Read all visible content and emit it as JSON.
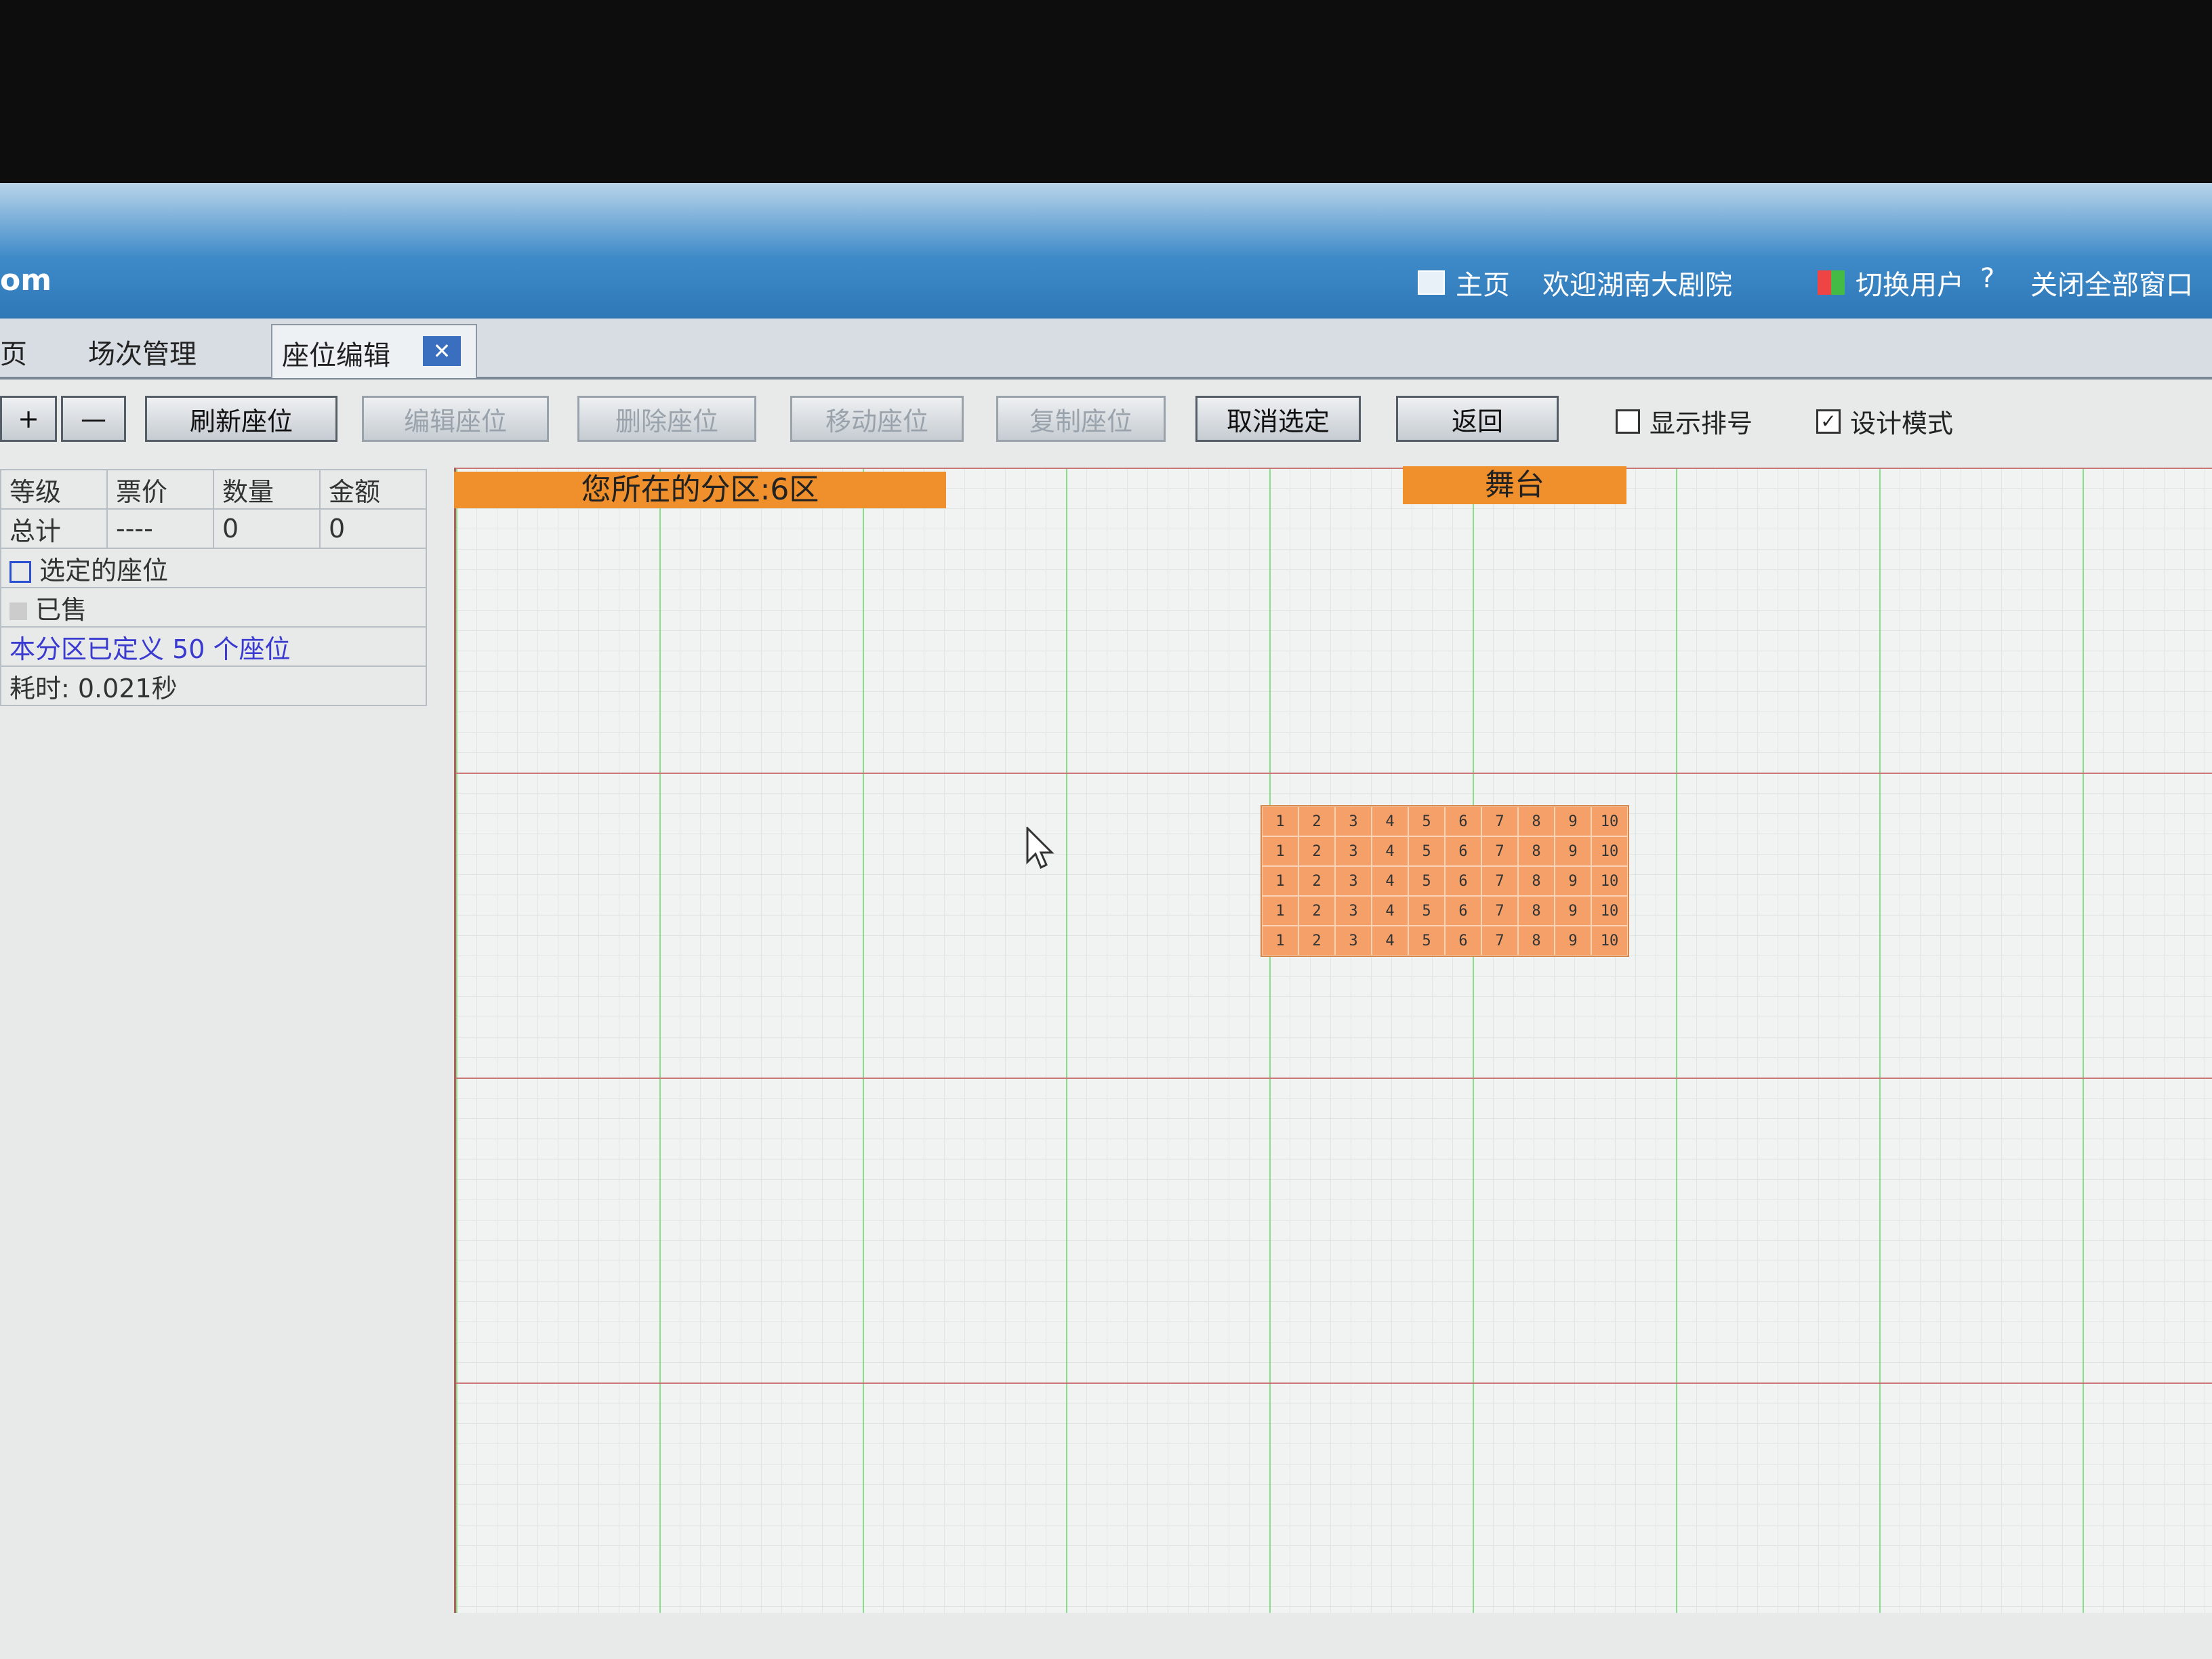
{
  "app": {
    "logo": "om",
    "home_label": "主页",
    "welcome": "欢迎湖南大剧院",
    "switch_user": "切换用户",
    "close_all": "关闭全部窗口"
  },
  "tabs": [
    {
      "label": "页"
    },
    {
      "label": "场次管理"
    },
    {
      "label": "座位编辑"
    }
  ],
  "toolbar": {
    "plus": "+",
    "minus": "—",
    "refresh": "刷新座位",
    "edit": "编辑座位",
    "delete": "删除座位",
    "move": "移动座位",
    "copy": "复制座位",
    "cancel": "取消选定",
    "back": "返回",
    "show_row": "显示排号",
    "design_mode": "设计模式"
  },
  "summary": {
    "headers": [
      "等级",
      "票价",
      "数量",
      "金额"
    ],
    "total_label": "总计",
    "total_price": "----",
    "total_qty": "0",
    "total_amount": "0",
    "selected": "选定的座位",
    "sold": "已售",
    "defined": "本分区已定义 50 个座位",
    "elapsed": "耗时: 0.021秒"
  },
  "map": {
    "zone": "您所在的分区:6区",
    "stage": "舞台",
    "rows": 5,
    "seats": [
      "1",
      "2",
      "3",
      "4",
      "5",
      "6",
      "7",
      "8",
      "9",
      "10"
    ]
  },
  "colors": {
    "accent": "#f0902c",
    "titlebar": "#3e8ac8"
  }
}
